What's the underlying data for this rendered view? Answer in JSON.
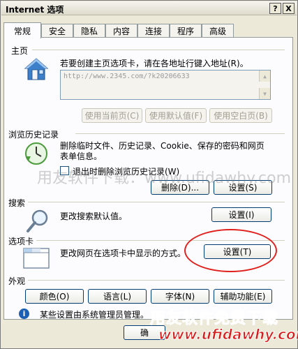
{
  "window": {
    "title": "Internet 选项",
    "help_label": "?",
    "close_label": "X"
  },
  "tabs": [
    {
      "label": "常规",
      "active": true
    },
    {
      "label": "安全"
    },
    {
      "label": "隐私"
    },
    {
      "label": "内容"
    },
    {
      "label": "连接"
    },
    {
      "label": "程序"
    },
    {
      "label": "高级"
    }
  ],
  "homepage": {
    "section_title": "主页",
    "description": "若要创建主页选项卡，请在各地址行键入地址(R)。",
    "url": "http://www.2345.com/?k20206633",
    "use_current": "使用当前页(C)",
    "use_default": "使用默认值(F)",
    "use_blank": "使用空白页(B)"
  },
  "history": {
    "section_title": "浏览历史记录",
    "description": "删除临时文件、历史记录、Cookie、保存的密码和网页表单信息。",
    "checkbox_label": "退出时删除浏览历史记录(W)",
    "delete_button": "删除(D)...",
    "settings_button": "设置(S)"
  },
  "search": {
    "section_title": "搜索",
    "description": "更改搜索默认值。",
    "settings_button": "设置(I)"
  },
  "tabs_section": {
    "section_title": "选项卡",
    "description": "更改网页在选项卡中显示的方式。",
    "settings_button": "设置(T)"
  },
  "appearance": {
    "section_title": "外观",
    "colors_button": "颜色(O)",
    "languages_button": "语言(L)",
    "fonts_button": "字体(N)",
    "accessibility_button": "辅助功能(E)"
  },
  "info_bar": {
    "text": "某些设置由系统管理员管理。"
  },
  "footer": {
    "ok_button_partial": "确"
  },
  "overlays": {
    "watermark": "用友软件下载：www.ufidawhy.com",
    "brand_title": "用友软件免费下载",
    "brand_url": "www.ufidawhy.com"
  }
}
